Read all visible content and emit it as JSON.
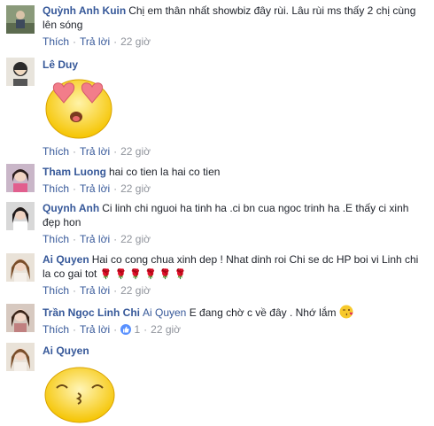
{
  "common": {
    "like_label": "Thích",
    "reply_label": "Trả lời",
    "sep": "·"
  },
  "comments": [
    {
      "author": "Quỳnh Anh Kuin",
      "text": "Chị em thân nhất showbiz đây rùi. Lâu rùi ms thấy 2 chị cùng lên sóng",
      "time": "22 giờ"
    },
    {
      "author": "Lê Duy",
      "sticker": "heart-eyes-emoji",
      "time": "22 giờ"
    },
    {
      "author": "Tham Luong",
      "text": "hai co tien la hai co tien",
      "time": "22 giờ"
    },
    {
      "author": "Quynh Anh",
      "text": "Ci linh chi nguoi ha tinh ha .ci bn cua ngoc trinh ha .E thấy ci xinh đẹp hon",
      "time": "22 giờ"
    },
    {
      "author": "Ai Quyen",
      "text": "Hai co cong chua xinh dep ! Nhat dinh roi Chi se dc HP boi vi Linh chi la co gai tot",
      "emoji": "rose-emoji",
      "emoji_count": 6,
      "time": "22 giờ"
    },
    {
      "author": "Trần Ngọc Linh Chi",
      "mention": "Ai Quyen",
      "text": "E đang chờ c về đây . Nhớ lắm",
      "emoji": "kiss-emoji",
      "reaction_icon": "like-icon",
      "reaction_count": "1",
      "time": "22 giờ"
    },
    {
      "author": "Ai Quyen",
      "sticker": "kiss-face-emoji"
    }
  ]
}
